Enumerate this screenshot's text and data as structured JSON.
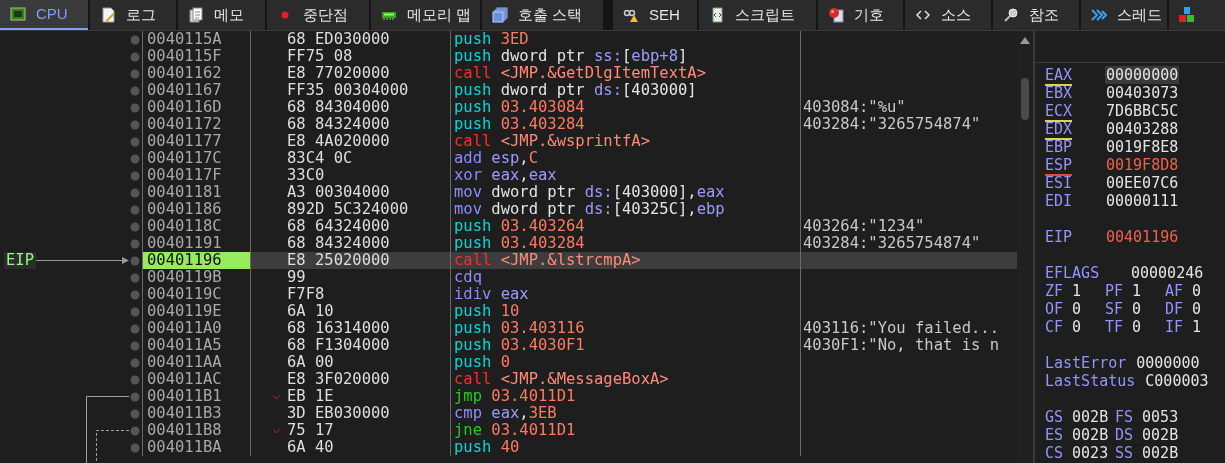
{
  "tabs": [
    {
      "label": "CPU",
      "selected": true
    },
    {
      "label": "로그",
      "selected": false
    },
    {
      "label": "메모",
      "selected": false
    },
    {
      "label": "중단점",
      "selected": false
    },
    {
      "label": "메모리 맵",
      "selected": false
    },
    {
      "label": "호출 스택",
      "selected": false
    },
    {
      "label": "SEH",
      "selected": false
    },
    {
      "label": "스크립트",
      "selected": false
    },
    {
      "label": "기호",
      "selected": false
    },
    {
      "label": "소스",
      "selected": false
    },
    {
      "label": "참조",
      "selected": false
    },
    {
      "label": "스레드",
      "selected": false
    },
    {
      "selected": false
    }
  ],
  "disassembly": {
    "rows": [
      {
        "address": "0040115A",
        "bytes": "68 ED030000",
        "mnemonic": "push",
        "kind": "push",
        "operands": [
          {
            "text": "3ED",
            "kind": "number"
          }
        ],
        "selected": false
      },
      {
        "address": "0040115F",
        "bytes": "FF75 08",
        "mnemonic": "push",
        "kind": "push",
        "operands": [
          {
            "text": "dword ptr ",
            "kind": "plain"
          },
          {
            "text": "ss:",
            "kind": "segment"
          },
          {
            "text": "[",
            "kind": "plain"
          },
          {
            "text": "ebp+8",
            "kind": "register"
          },
          {
            "text": "]",
            "kind": "plain"
          }
        ],
        "selected": false
      },
      {
        "address": "00401162",
        "bytes": "E8 77020000",
        "mnemonic": "call",
        "kind": "call",
        "operands": [
          {
            "text": "<JMP.&GetDlgItemTextA>",
            "kind": "label"
          }
        ],
        "selected": false
      },
      {
        "address": "00401167",
        "bytes": "FF35 00304000",
        "mnemonic": "push",
        "kind": "push",
        "operands": [
          {
            "text": "dword ptr ",
            "kind": "plain"
          },
          {
            "text": "ds:",
            "kind": "segment"
          },
          {
            "text": "[403000]",
            "kind": "plain"
          }
        ],
        "selected": false
      },
      {
        "address": "0040116D",
        "bytes": "68 84304000",
        "mnemonic": "push",
        "kind": "push",
        "operands": [
          {
            "text": "03.403084",
            "kind": "number"
          }
        ],
        "comment": "403084:\"%u\"",
        "selected": false
      },
      {
        "address": "00401172",
        "bytes": "68 84324000",
        "mnemonic": "push",
        "kind": "push",
        "operands": [
          {
            "text": "03.403284",
            "kind": "number"
          }
        ],
        "comment": "403284:\"3265754874\"",
        "selected": false
      },
      {
        "address": "00401177",
        "bytes": "E8 4A020000",
        "mnemonic": "call",
        "kind": "call",
        "operands": [
          {
            "text": "<JMP.&wsprintfA>",
            "kind": "label"
          }
        ],
        "selected": false
      },
      {
        "address": "0040117C",
        "bytes": "83C4 0C",
        "mnemonic": "add",
        "kind": "other",
        "operands": [
          {
            "text": "esp",
            "kind": "register"
          },
          {
            "text": ",",
            "kind": "plain"
          },
          {
            "text": "C",
            "kind": "number"
          }
        ],
        "selected": false
      },
      {
        "address": "0040117F",
        "bytes": "33C0",
        "mnemonic": "xor",
        "kind": "other",
        "operands": [
          {
            "text": "eax",
            "kind": "register"
          },
          {
            "text": ",",
            "kind": "plain"
          },
          {
            "text": "eax",
            "kind": "register"
          }
        ],
        "selected": false
      },
      {
        "address": "00401181",
        "bytes": "A3 00304000",
        "mnemonic": "mov",
        "kind": "other",
        "operands": [
          {
            "text": "dword ptr ",
            "kind": "plain"
          },
          {
            "text": "ds:",
            "kind": "segment"
          },
          {
            "text": "[403000],",
            "kind": "plain"
          },
          {
            "text": "eax",
            "kind": "register"
          }
        ],
        "selected": false
      },
      {
        "address": "00401186",
        "bytes": "892D 5C324000",
        "mnemonic": "mov",
        "kind": "other",
        "operands": [
          {
            "text": "dword ptr ",
            "kind": "plain"
          },
          {
            "text": "ds:",
            "kind": "segment"
          },
          {
            "text": "[40325C],",
            "kind": "plain"
          },
          {
            "text": "ebp",
            "kind": "register"
          }
        ],
        "selected": false
      },
      {
        "address": "0040118C",
        "bytes": "68 64324000",
        "mnemonic": "push",
        "kind": "push",
        "operands": [
          {
            "text": "03.403264",
            "kind": "number"
          }
        ],
        "comment": "403264:\"1234\"",
        "selected": false
      },
      {
        "address": "00401191",
        "bytes": "68 84324000",
        "mnemonic": "push",
        "kind": "push",
        "operands": [
          {
            "text": "03.403284",
            "kind": "number"
          }
        ],
        "comment": "403284:\"3265754874\"",
        "selected": false
      },
      {
        "address": "00401196",
        "bytes": "E8 25020000",
        "mnemonic": "call",
        "kind": "call",
        "operands": [
          {
            "text": "<JMP.&lstrcmpA>",
            "kind": "label"
          }
        ],
        "selected": true,
        "gutter_label": "EIP"
      },
      {
        "address": "0040119B",
        "bytes": "99",
        "mnemonic": "cdq",
        "kind": "other",
        "operands": [],
        "selected": false
      },
      {
        "address": "0040119C",
        "bytes": "F7F8",
        "mnemonic": "idiv",
        "kind": "other",
        "operands": [
          {
            "text": "eax",
            "kind": "register"
          }
        ],
        "selected": false
      },
      {
        "address": "0040119E",
        "bytes": "6A 10",
        "mnemonic": "push",
        "kind": "push",
        "operands": [
          {
            "text": "10",
            "kind": "number"
          }
        ],
        "selected": false
      },
      {
        "address": "004011A0",
        "bytes": "68 16314000",
        "mnemonic": "push",
        "kind": "push",
        "operands": [
          {
            "text": "03.403116",
            "kind": "number"
          }
        ],
        "comment": "403116:\"You failed...",
        "selected": false
      },
      {
        "address": "004011A5",
        "bytes": "68 F1304000",
        "mnemonic": "push",
        "kind": "push",
        "operands": [
          {
            "text": "03.4030F1",
            "kind": "number"
          }
        ],
        "comment": "4030F1:\"No, that is n",
        "selected": false
      },
      {
        "address": "004011AA",
        "bytes": "6A 00",
        "mnemonic": "push",
        "kind": "push",
        "operands": [
          {
            "text": "0",
            "kind": "number"
          }
        ],
        "selected": false
      },
      {
        "address": "004011AC",
        "bytes": "E8 3F020000",
        "mnemonic": "call",
        "kind": "call",
        "operands": [
          {
            "text": "<JMP.&MessageBoxA>",
            "kind": "label"
          }
        ],
        "selected": false
      },
      {
        "address": "004011B1",
        "bytes": "EB 1E",
        "mnemonic": "jmp",
        "kind": "jump",
        "operands": [
          {
            "text": "03.4011D1",
            "kind": "number"
          }
        ],
        "selected": false,
        "jump_arrow": true,
        "branch_line": true,
        "dashed": false
      },
      {
        "address": "004011B3",
        "bytes": "3D EB030000",
        "mnemonic": "cmp",
        "kind": "other",
        "operands": [
          {
            "text": "eax",
            "kind": "register"
          },
          {
            "text": ",",
            "kind": "plain"
          },
          {
            "text": "3EB",
            "kind": "number"
          }
        ],
        "selected": false
      },
      {
        "address": "004011B8",
        "bytes": "75 17",
        "mnemonic": "jne",
        "kind": "jump",
        "operands": [
          {
            "text": "03.4011D1",
            "kind": "number"
          }
        ],
        "selected": false,
        "jump_arrow": true,
        "branch_line": true,
        "dashed": true
      },
      {
        "address": "004011BA",
        "bytes": "6A 40",
        "mnemonic": "push",
        "kind": "push",
        "operands": [
          {
            "text": "40",
            "kind": "number"
          }
        ],
        "selected": false
      }
    ]
  },
  "registers": {
    "general": [
      {
        "name": "EAX",
        "value": "00000000",
        "color": "#d8d84a",
        "changed": false,
        "selected": true
      },
      {
        "name": "EBX",
        "value": "00403073",
        "changed": false,
        "selected": false
      },
      {
        "name": "ECX",
        "value": "7D6BBC5C",
        "color": "#d8d84a",
        "changed": false,
        "selected": false
      },
      {
        "name": "EDX",
        "value": "00403288",
        "color": "#d8d84a",
        "changed": false,
        "selected": false
      },
      {
        "name": "EBP",
        "value": "0019F8E8",
        "changed": false,
        "selected": false
      },
      {
        "name": "ESP",
        "value": "0019F8D8",
        "color": "#e04848",
        "changed": true,
        "selected": false
      },
      {
        "name": "ESI",
        "value": "00EE07C6",
        "changed": false,
        "selected": false
      },
      {
        "name": "EDI",
        "value": "00000111",
        "changed": false,
        "selected": false
      }
    ],
    "eip": {
      "name": "EIP",
      "value": "00401196",
      "changed": true
    },
    "eflags": {
      "name": "EFLAGS",
      "value": "00000246"
    },
    "flag_rows": [
      [
        {
          "name": "ZF",
          "value": "1"
        },
        {
          "name": "PF",
          "value": "1"
        },
        {
          "name": "AF",
          "value": "0"
        }
      ],
      [
        {
          "name": "OF",
          "value": "0"
        },
        {
          "name": "SF",
          "value": "0"
        },
        {
          "name": "DF",
          "value": "0"
        }
      ],
      [
        {
          "name": "CF",
          "value": "0"
        },
        {
          "name": "TF",
          "value": "0"
        },
        {
          "name": "IF",
          "value": "1"
        }
      ]
    ],
    "last": [
      {
        "name": "LastError",
        "value": "0000000"
      },
      {
        "name": "LastStatus",
        "value": "C000003"
      }
    ],
    "segment_rows": [
      [
        {
          "name": "GS",
          "value": "002B"
        },
        {
          "name": "FS",
          "value": "0053"
        }
      ],
      [
        {
          "name": "ES",
          "value": "002B"
        },
        {
          "name": "DS",
          "value": "002B"
        }
      ],
      [
        {
          "name": "CS",
          "value": "0023"
        },
        {
          "name": "SS",
          "value": "002B"
        }
      ]
    ]
  }
}
